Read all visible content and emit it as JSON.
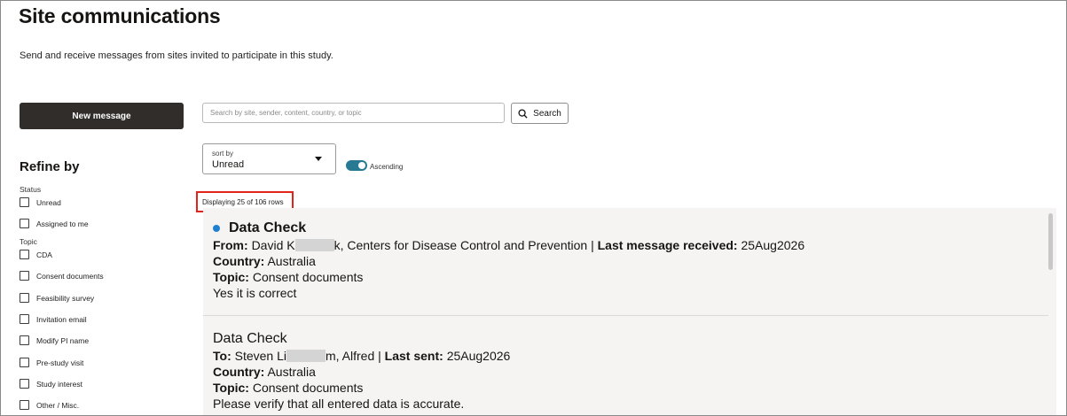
{
  "header": {
    "title": "Site communications",
    "subtitle": "Send and receive messages from sites invited to participate in this study."
  },
  "actions": {
    "new_message": "New message"
  },
  "search": {
    "placeholder": "Search by site, sender, content, country, or topic",
    "button_label": "Search"
  },
  "sort": {
    "label": "sort by",
    "value": "Unread",
    "ascending_label": "Ascending",
    "ascending_on": true
  },
  "rows_info": "Displaying 25 of 106 rows",
  "refine": {
    "title": "Refine by",
    "status_label": "Status",
    "status_items": [
      {
        "label": "Unread"
      },
      {
        "label": "Assigned to me"
      }
    ],
    "topic_label": "Topic",
    "topic_items": [
      {
        "label": "CDA"
      },
      {
        "label": "Consent documents"
      },
      {
        "label": "Feasibility survey"
      },
      {
        "label": "Invitation email"
      },
      {
        "label": "Modify PI name"
      },
      {
        "label": "Pre-study visit"
      },
      {
        "label": "Study interest"
      },
      {
        "label": "Other / Misc."
      }
    ]
  },
  "messages": [
    {
      "unread": true,
      "title": "Data Check",
      "party_label": "From:",
      "party_name_start": "David K",
      "party_name_end": "k, Centers for Disease Control and Prevention |",
      "date_label": "Last message received:",
      "date": "25Aug2026",
      "country_label": "Country:",
      "country": "Australia",
      "topic_label": "Topic:",
      "topic": "Consent documents",
      "body": "Yes it is correct"
    },
    {
      "unread": false,
      "title": "Data Check",
      "party_label": "To:",
      "party_name_start": "Steven Li",
      "party_name_end": "m, Alfred |",
      "date_label": "Last sent:",
      "date": "25Aug2026",
      "country_label": "Country:",
      "country": "Australia",
      "topic_label": "Topic:",
      "topic": "Consent documents",
      "body": "Please verify that all entered data is accurate."
    }
  ],
  "colors": {
    "primary_button": "#312d2a",
    "toggle_on": "#287a94",
    "unread_dot": "#227fd0",
    "highlight_box": "#e2231a",
    "panel_bg": "#f5f4f2"
  }
}
